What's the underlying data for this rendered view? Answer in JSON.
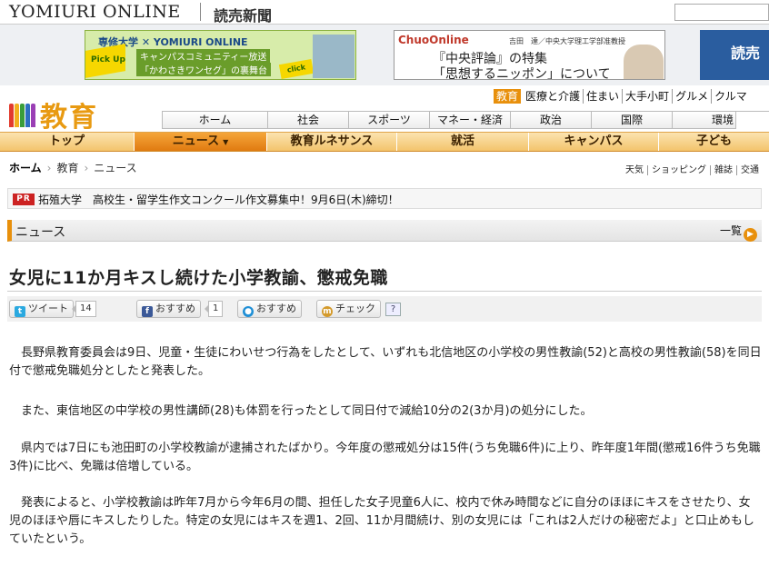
{
  "header": {
    "brand": "YOMIURI ONLINE",
    "brand_jp": "読売新聞"
  },
  "banners": {
    "senshu": {
      "title": "専修大学 ✕ YOMIURI ONLINE",
      "pickup": "Pick Up",
      "line1": "キャンパスコミュニティー放送",
      "line2": "「かわさきワンセグ」の裏舞台",
      "click": "click"
    },
    "chuo": {
      "title": "ChuoOnline",
      "subtitle": "吉田　達／中央大学理工学部准教授",
      "line1": "『中央評論』の特集",
      "line2": "「思想するニッポン」について"
    },
    "third": {
      "text": "読売"
    }
  },
  "section": {
    "title": "教育",
    "colors": {
      "accent": "#e8900c"
    }
  },
  "category_links": [
    "教育",
    "医療と介護",
    "住まい",
    "大手小町",
    "グルメ",
    "クルマ"
  ],
  "main_nav": [
    "ホーム",
    "社会",
    "スポーツ",
    "マネー・経済",
    "政治",
    "国際",
    "環境"
  ],
  "section_nav": [
    "トップ",
    "ニュース",
    "教育ルネサンス",
    "就活",
    "キャンパス",
    "子ども"
  ],
  "breadcrumb": [
    "ホーム",
    "教育",
    "ニュース"
  ],
  "util_links": [
    "天気",
    "ショッピング",
    "雑誌",
    "交通"
  ],
  "pr": {
    "tag": "PR",
    "text": "拓殖大学　高校生・留学生作文コンクール作文募集中！9月6日(木)締切！"
  },
  "news_header": {
    "title": "ニュース",
    "all_label": "一覧"
  },
  "article": {
    "headline": "女児に11か月キスし続けた小学教諭、懲戒免職",
    "share": {
      "tweet_label": "ツイート",
      "tweet_count": "14",
      "fb_label": "おすすめ",
      "fb_count": "1",
      "mixi_label": "おすすめ",
      "check_label": "チェック",
      "help_label": "?"
    },
    "paragraphs": [
      "長野県教育委員会は9日、児童・生徒にわいせつ行為をしたとして、いずれも北信地区の小学校の男性教諭(52)と高校の男性教諭(58)を同日付で懲戒免職処分としたと発表した。",
      "また、東信地区の中学校の男性講師(28)も体罰を行ったとして同日付で減給10分の2(3か月)の処分にした。",
      "県内では7日にも池田町の小学校教諭が逮捕されたばかり。今年度の懲戒処分は15件(うち免職6件)に上り、昨年度1年間(懲戒16件うち免職3件)に比べ、免職は倍増している。",
      "発表によると、小学校教諭は昨年7月から今年6月の間、担任した女子児童6人に、校内で休み時間などに自分のほほにキスをさせたり、女児のほほや唇にキスしたりした。特定の女児にはキスを週1、2回、11か月間続け、別の女児には「これは2人だけの秘密だよ」と口止めもしていたという。"
    ]
  }
}
